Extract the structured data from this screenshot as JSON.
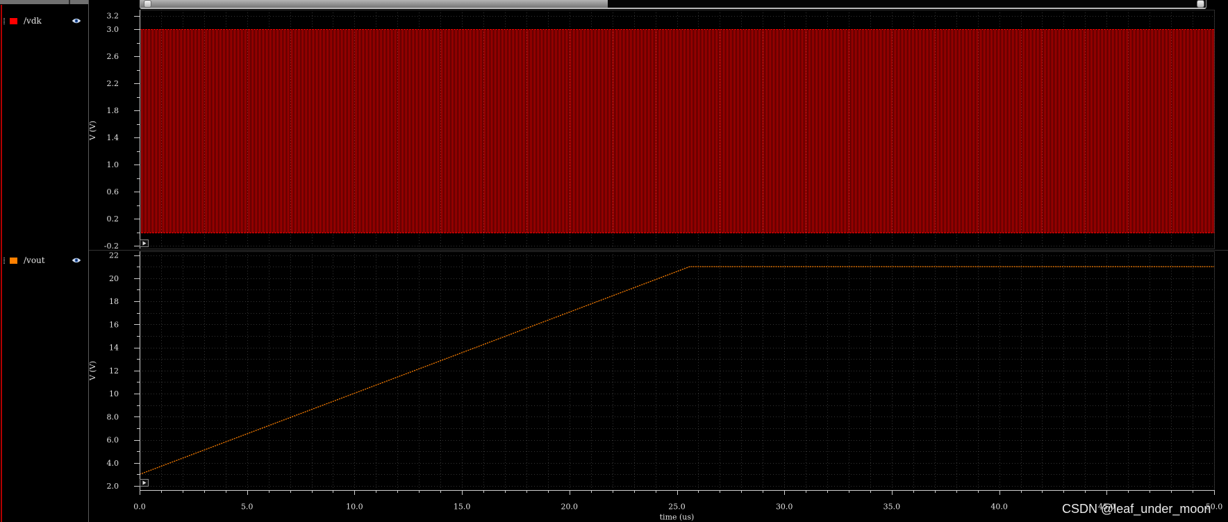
{
  "theme": {
    "background": "#000000",
    "text": "#e2e2e2",
    "grid": "#353535",
    "axis": "#cfcfcf"
  },
  "icons": {
    "visibility": "eye-icon",
    "expand": "play-icon",
    "handle": "drag-handle-icon"
  },
  "watermark": "CSDN @leaf_under_moon",
  "chart_data": [
    {
      "type": "line",
      "ylabel": "V (V)",
      "ylim": [
        -0.2,
        3.2
      ],
      "yticks": [
        "3.2",
        "3.0",
        "2.6",
        "2.2",
        "1.8",
        "1.4",
        "1.0",
        "0.6",
        "0.2",
        "-0.2"
      ],
      "xlim": [
        0,
        50
      ],
      "grid": true,
      "series": [
        {
          "name": "/vdk",
          "color": "#ff0000",
          "type": "square-wave",
          "x": [
            0,
            50
          ],
          "low": 0.0,
          "high": 3.0
        }
      ]
    },
    {
      "type": "line",
      "ylabel": "V (V)",
      "xlabel": "time (us)",
      "ylim": [
        2.0,
        22
      ],
      "yticks": [
        "22",
        "20",
        "18",
        "16",
        "14",
        "12",
        "10",
        "8.0",
        "6.0",
        "4.0",
        "2.0"
      ],
      "xlim": [
        0,
        50
      ],
      "xticks": [
        "0.0",
        "5.0",
        "10.0",
        "15.0",
        "20.0",
        "25.0",
        "30.0",
        "35.0",
        "40.0",
        "45.0",
        "50.0"
      ],
      "grid": true,
      "series": [
        {
          "name": "/vout",
          "color": "#ff8000",
          "x": [
            0,
            25.6,
            50
          ],
          "y": [
            3.0,
            21.0,
            21.0
          ]
        }
      ]
    }
  ]
}
